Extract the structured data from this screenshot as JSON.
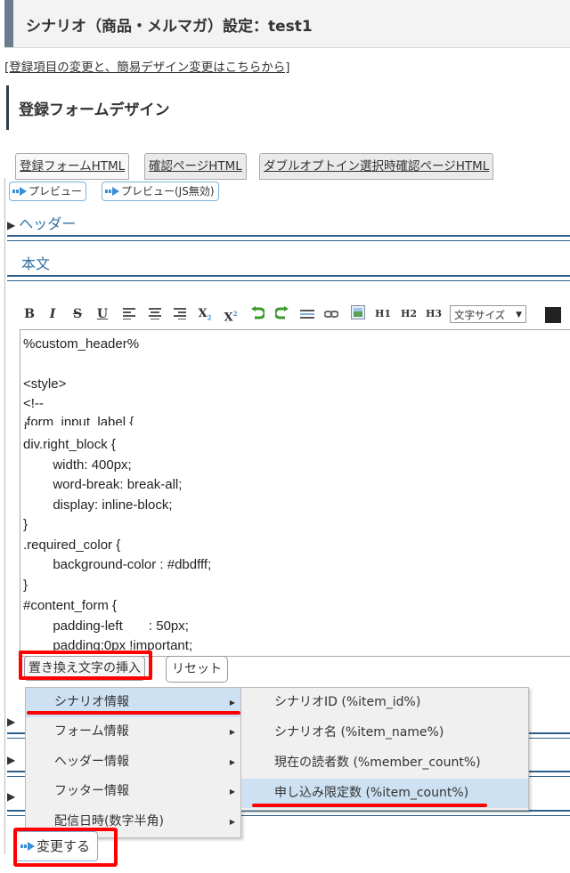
{
  "header": {
    "title": "シナリオ（商品・メルマガ）設定：test1"
  },
  "design_link": "[登録項目の変更と、簡易デザイン変更はこちらから]",
  "section": {
    "title": "登録フォームデザイン"
  },
  "tabs": [
    {
      "label": "登録フォームHTML"
    },
    {
      "label": "確認ページHTML"
    },
    {
      "label": "ダブルオプトイン選択時確認ページHTML"
    }
  ],
  "preview": {
    "label": "プレビュー",
    "js_off_label": "プレビュー(JS無効)"
  },
  "accordion": {
    "header_label": "ヘッダー",
    "body_label": "本文"
  },
  "toolbar": {
    "bold": "B",
    "italic": "I",
    "strike": "S",
    "underline": "U",
    "subscript": "X",
    "superscript": "X",
    "h1": "H1",
    "h2": "H2",
    "h3": "H3",
    "font_size": "文字サイズ"
  },
  "editor": {
    "lines": [
      "%custom_header%",
      "",
      "<style>",
      "<!--",
      ".form_input_label {",
      "div.right_block {",
      "        width: 400px;",
      "        word-break: break-all;",
      "        display: inline-block;",
      "}",
      ".required_color {",
      "        background-color : #dbdfff;",
      "}",
      "#content_form {",
      "        padding-left       : 50px;",
      "        padding:0px !important;"
    ]
  },
  "buttons": {
    "insert": "置き換え文字の挿入",
    "reset": "リセット",
    "submit": "変更する"
  },
  "menu": {
    "items": [
      {
        "label": "シナリオ情報"
      },
      {
        "label": "フォーム情報"
      },
      {
        "label": "ヘッダー情報"
      },
      {
        "label": "フッター情報"
      },
      {
        "label": "配信日時(数字半角)"
      }
    ],
    "submenu": [
      {
        "label": "シナリオID (%item_id%)"
      },
      {
        "label": "シナリオ名 (%item_name%)"
      },
      {
        "label": "現在の読者数 (%member_count%)"
      },
      {
        "label": "申し込み限定数 (%item_count%)"
      }
    ]
  },
  "colors": {
    "accent": "#2d5f8b",
    "highlight": "#ff0000",
    "menu_hover": "#cde1f3"
  }
}
